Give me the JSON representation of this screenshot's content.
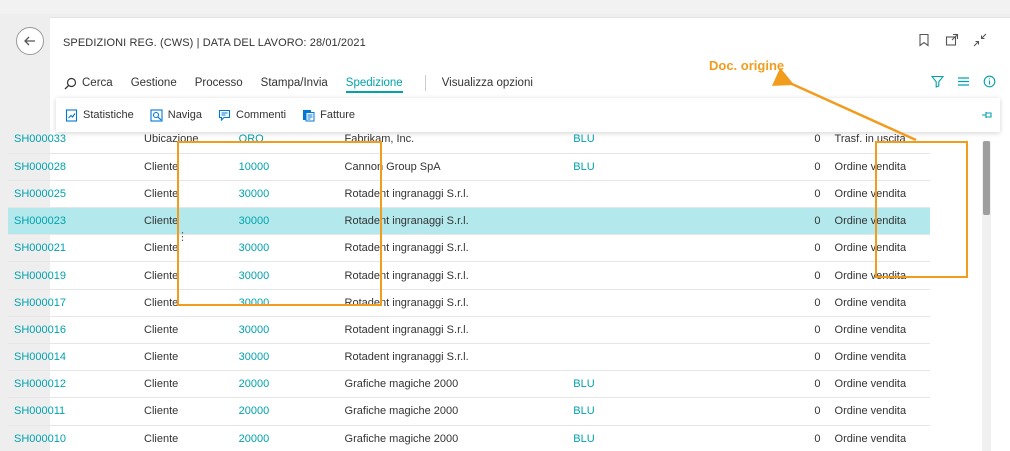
{
  "page": {
    "title": "SPEDIZIONI REG. (CWS) | DATA DEL LAVORO: 28/01/2021"
  },
  "menu": {
    "search": "Cerca",
    "items": [
      "Gestione",
      "Processo",
      "Stampa/Invia",
      "Spedizione"
    ],
    "view_options": "Visualizza opzioni"
  },
  "actions": [
    "Statistiche",
    "Naviga",
    "Commenti",
    "Fatture"
  ],
  "rows": [
    {
      "no": "SH000033",
      "type": "Ubicazione",
      "code": "ORO",
      "name": "Fabrikam, Inc.",
      "location": "BLU",
      "qty": "0",
      "doc": "Trasf. in uscita"
    },
    {
      "no": "SH000028",
      "type": "Cliente",
      "code": "10000",
      "name": "Cannon Group SpA",
      "location": "BLU",
      "qty": "0",
      "doc": "Ordine vendita"
    },
    {
      "no": "SH000025",
      "type": "Cliente",
      "code": "30000",
      "name": "Rotadent ingranaggi S.r.l.",
      "location": "",
      "qty": "0",
      "doc": "Ordine vendita"
    },
    {
      "no": "SH000023",
      "type": "Cliente",
      "code": "30000",
      "name": "Rotadent ingranaggi S.r.l.",
      "location": "",
      "qty": "0",
      "doc": "Ordine vendita"
    },
    {
      "no": "SH000021",
      "type": "Cliente",
      "code": "30000",
      "name": "Rotadent ingranaggi S.r.l.",
      "location": "",
      "qty": "0",
      "doc": "Ordine vendita"
    },
    {
      "no": "SH000019",
      "type": "Cliente",
      "code": "30000",
      "name": "Rotadent ingranaggi S.r.l.",
      "location": "",
      "qty": "0",
      "doc": "Ordine vendita"
    },
    {
      "no": "SH000017",
      "type": "Cliente",
      "code": "30000",
      "name": "Rotadent ingranaggi S.r.l.",
      "location": "",
      "qty": "0",
      "doc": "Ordine vendita"
    },
    {
      "no": "SH000016",
      "type": "Cliente",
      "code": "30000",
      "name": "Rotadent ingranaggi S.r.l.",
      "location": "",
      "qty": "0",
      "doc": "Ordine vendita"
    },
    {
      "no": "SH000014",
      "type": "Cliente",
      "code": "30000",
      "name": "Rotadent ingranaggi S.r.l.",
      "location": "",
      "qty": "0",
      "doc": "Ordine vendita"
    },
    {
      "no": "SH000012",
      "type": "Cliente",
      "code": "20000",
      "name": "Grafiche magiche 2000",
      "location": "BLU",
      "qty": "0",
      "doc": "Ordine vendita"
    },
    {
      "no": "SH000011",
      "type": "Cliente",
      "code": "20000",
      "name": "Grafiche magiche 2000",
      "location": "BLU",
      "qty": "0",
      "doc": "Ordine vendita"
    },
    {
      "no": "SH000010",
      "type": "Cliente",
      "code": "20000",
      "name": "Grafiche magiche 2000",
      "location": "BLU",
      "qty": "0",
      "doc": "Ordine vendita"
    }
  ],
  "selected_row": 3,
  "annotation": {
    "callout": "Doc. origine",
    "color": "#f29c1e"
  },
  "colors": {
    "accent": "#00a2ad",
    "selected_row": "#b3e9ec"
  }
}
